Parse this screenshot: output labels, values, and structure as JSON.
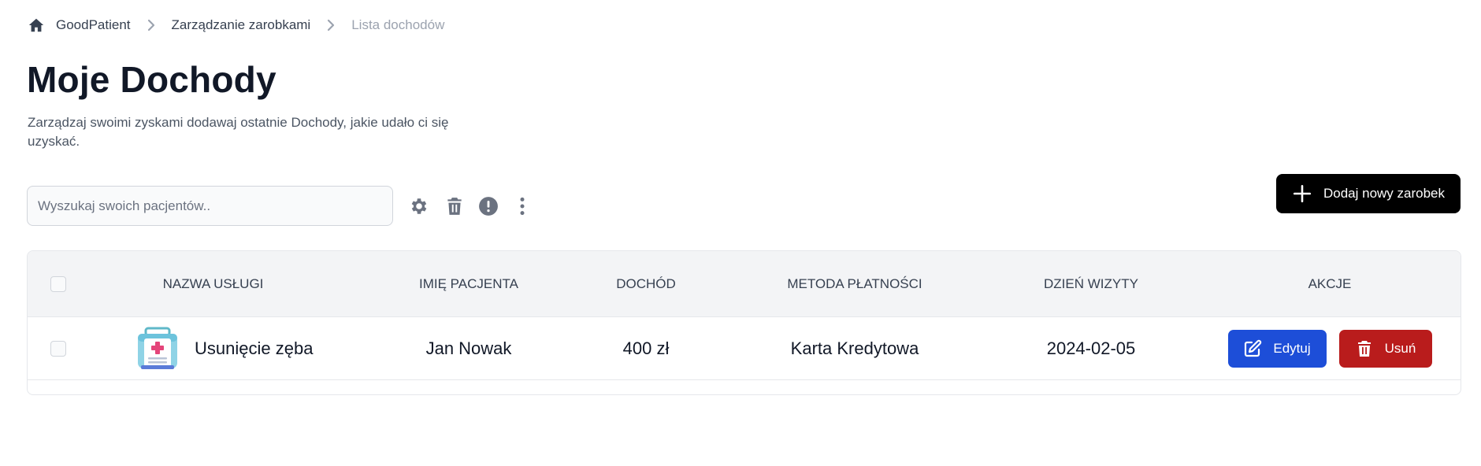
{
  "breadcrumb": {
    "home_icon": "home-icon",
    "items": [
      "GoodPatient",
      "Zarządzanie zarobkami",
      "Lista dochodów"
    ],
    "separator_icon": "chevron-right-icon"
  },
  "page": {
    "title": "Moje Dochody",
    "description": "Zarządzaj swoimi zyskami dodawaj ostatnie Dochody, jakie udało ci się uzyskać."
  },
  "toolbar": {
    "search_placeholder": "Wyszukaj swoich pacjentów..",
    "search_value": "",
    "icons": [
      "gear-icon",
      "trash-icon",
      "exclamation-circle-icon",
      "dots-vertical-icon"
    ],
    "add_button_label": "Dodaj nowy zarobek",
    "add_button_icon": "plus-icon"
  },
  "table": {
    "columns": [
      "Nazwa usługi",
      "Imię pacjenta",
      "Dochód",
      "Metoda płatności",
      "Dzień wizyty",
      "Akcje"
    ],
    "rows": [
      {
        "service_icon": "medical-kit-icon",
        "service": "Usunięcie zęba",
        "patient": "Jan Nowak",
        "income": "400 zł",
        "payment_method": "Karta Kredytowa",
        "visit_date": "2024-02-05",
        "edit_label": "Edytuj",
        "delete_label": "Usuń"
      }
    ]
  },
  "colors": {
    "primary_button": "#000000",
    "edit_button": "#1d4ed8",
    "delete_button": "#b91c1c",
    "header_bg": "#f3f4f6"
  }
}
